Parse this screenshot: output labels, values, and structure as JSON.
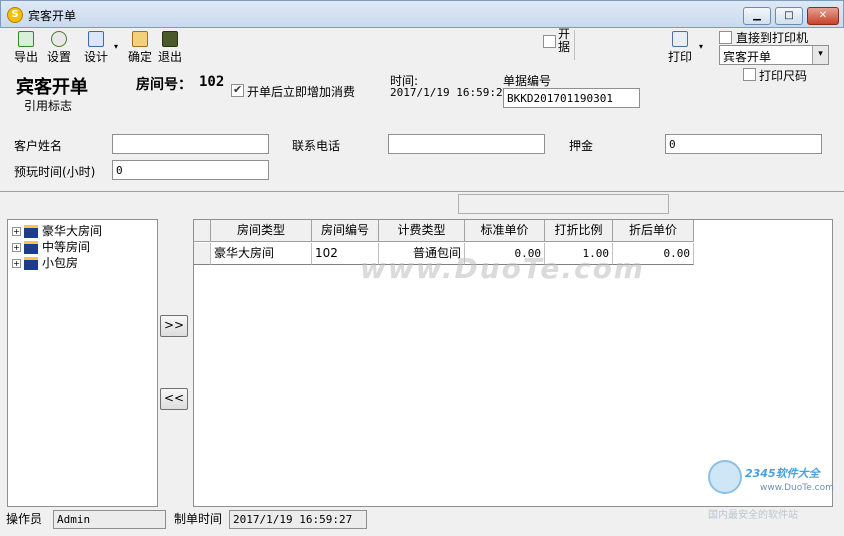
{
  "window": {
    "title": "宾客开单",
    "app_icon": "S",
    "min_glyph": "▁",
    "max_glyph": "□",
    "close_glyph": "✕"
  },
  "toolbar": {
    "export_label": "导出",
    "settings_label": "设置",
    "design_label": "设计",
    "confirm_label": "确定",
    "exit_label": "退出",
    "print_label": "打印",
    "caret": "▾",
    "partial_check_label": "开\n据",
    "direct_print_label": "直接到打印机",
    "print_template_value": "宾客开单",
    "print_size_label": "打印尺码"
  },
  "form": {
    "heading": "宾客开单",
    "ref_flag_label": "引用标志",
    "room_no_label": "房间号：",
    "room_no_value": "102",
    "add_consumption_label": "开单后立即增加消费",
    "time_label": "时间:",
    "time_value": "2017/1/19 16:59:29",
    "doc_no_label": "单据编号",
    "doc_no_value": "BKKD201701190301",
    "customer_name_label": "客户姓名",
    "customer_name_value": "",
    "phone_label": "联系电话",
    "phone_value": "",
    "deposit_label": "押金",
    "deposit_value": "0",
    "planned_hours_label": "预玩时间(小时)",
    "planned_hours_value": "0"
  },
  "tree": {
    "nodes": [
      {
        "expander": "+",
        "label": "豪华大房间"
      },
      {
        "expander": "+",
        "label": "中等房间"
      },
      {
        "expander": "+",
        "label": "小包房"
      }
    ]
  },
  "move_buttons": {
    "add": ">>",
    "remove": "<<"
  },
  "grid": {
    "columns": [
      "房间类型",
      "房间编号",
      "计费类型",
      "标准单价",
      "打折比例",
      "折后单价"
    ],
    "rows": [
      [
        "豪华大房间",
        "102",
        "普通包间",
        "0.00",
        "1.00",
        "0.00"
      ]
    ]
  },
  "status": {
    "operator_label": "操作员",
    "operator_value": "Admin",
    "created_time_label": "制单时间",
    "created_time_value": "2017/1/19 16:59:27"
  },
  "watermark": {
    "center": "www.DuoTe.com",
    "brand": "2345软件大全",
    "url": "www.DuoTe.com",
    "slogan": "国内最安全的软件站"
  },
  "colors": {
    "title_gradient_top": "#dfe9f5",
    "title_gradient_bottom": "#c9daee",
    "close_red": "#c7432c",
    "folder_blue": "#1d3c8a"
  }
}
